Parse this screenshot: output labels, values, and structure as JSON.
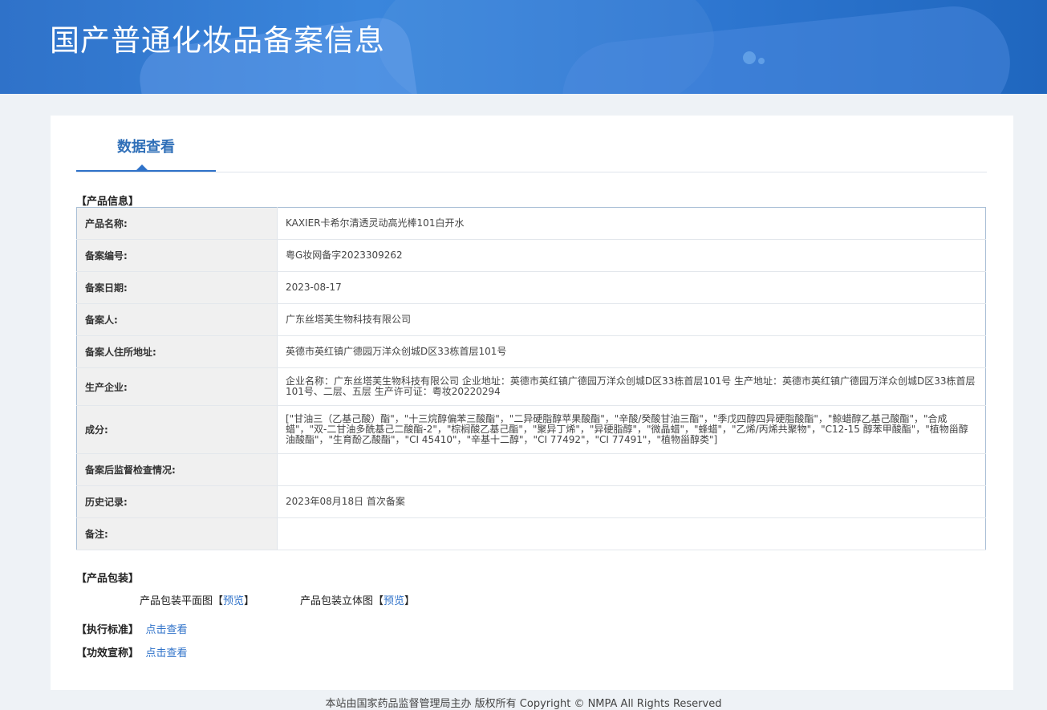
{
  "header": {
    "title": "国产普通化妆品备案信息"
  },
  "tabs": [
    {
      "label": "数据查看"
    }
  ],
  "product_info": {
    "section_label": "【产品信息】",
    "rows": [
      {
        "key": "产品名称:",
        "value": "KAXIER卡希尔清透灵动高光棒101白开水"
      },
      {
        "key": "备案编号:",
        "value": "粤G妆网备字2023309262"
      },
      {
        "key": "备案日期:",
        "value": "2023-08-17"
      },
      {
        "key": "备案人:",
        "value": "广东丝塔芙生物科技有限公司"
      },
      {
        "key": "备案人住所地址:",
        "value": "英德市英红镇广德园万洋众创城D区33栋首层101号"
      },
      {
        "key": "生产企业:",
        "value": "企业名称：广东丝塔芙生物科技有限公司 企业地址：英德市英红镇广德园万洋众创城D区33栋首层101号 生产地址：英德市英红镇广德园万洋众创城D区33栋首层101号、二层、五层 生产许可证：粤妆20220294"
      },
      {
        "key": "成分:",
        "value": "[\"甘油三（乙基己酸）酯\"，\"十三烷醇偏苯三酸酯\"，\"二异硬脂醇苹果酸酯\"，\"辛酸/癸酸甘油三酯\"，\"季戊四醇四异硬脂酸酯\"，\"鲸蜡醇乙基己酸酯\"，\"合成蜡\"，\"双-二甘油多酰基己二酸酯-2\"，\"棕榈酸乙基己酯\"，\"聚异丁烯\"，\"异硬脂醇\"，\"微晶蜡\"，\"蜂蜡\"，\"乙烯/丙烯共聚物\"，\"C12-15 醇苯甲酸酯\"，\"植物甾醇油酸酯\"，\"生育酚乙酸酯\"，\"CI 45410\"，\"辛基十二醇\"，\"CI 77492\"，\"CI 77491\"，\"植物甾醇类\"]"
      },
      {
        "key": "备案后监督检查情况:",
        "value": ""
      },
      {
        "key": "历史记录:",
        "value": "2023年08月18日 首次备案"
      },
      {
        "key": "备注:",
        "value": ""
      }
    ]
  },
  "packaging": {
    "section_label": "【产品包装】",
    "flat_label": "产品包装平面图",
    "flat_open": "【",
    "flat_link": "预览",
    "flat_close": "】",
    "solid_label": "产品包装立体图",
    "solid_open": "【",
    "solid_link": "预览",
    "solid_close": "】"
  },
  "standard": {
    "section_label": "【执行标准】",
    "link": "点击查看"
  },
  "efficacy": {
    "section_label": "【功效宣称】",
    "link": "点击查看"
  },
  "footer": {
    "text": "本站由国家药品监督管理局主办 版权所有 Copyright © NMPA All Rights Reserved"
  }
}
